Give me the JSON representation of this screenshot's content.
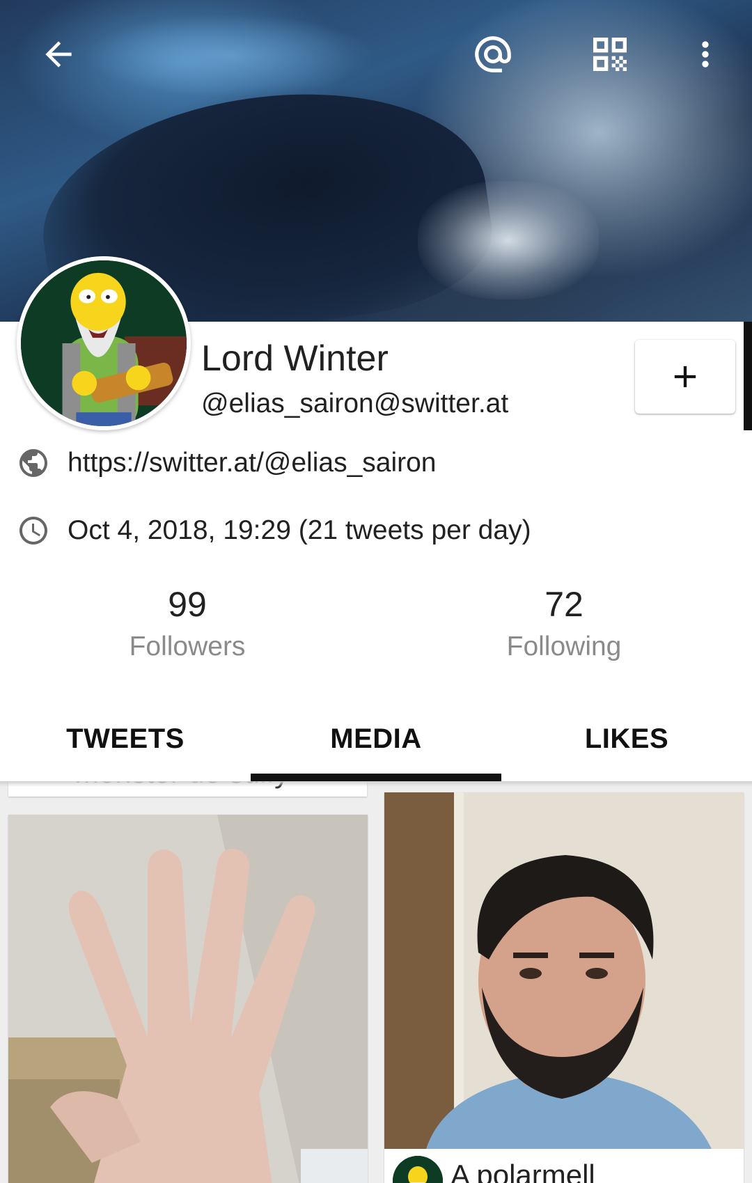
{
  "header": {
    "back_icon": "arrow-back-icon",
    "mention_icon": "at-icon",
    "qr_icon": "qr-code-icon",
    "menu_icon": "more-vert-icon"
  },
  "profile": {
    "display_name": "Lord Winter",
    "handle": "@elias_sairon@switter.at",
    "follow_label": "+",
    "website": "https://switter.at/@elias_sairon",
    "joined": "Oct 4, 2018, 19:29 (21 tweets per day)"
  },
  "stats": {
    "followers_count": "99",
    "followers_label": "Followers",
    "following_count": "72",
    "following_label": "Following"
  },
  "tabs": [
    {
      "label": "TWEETS"
    },
    {
      "label": "MEDIA",
      "selected": true
    },
    {
      "label": "LIKES"
    }
  ],
  "media": {
    "prev_card_text": "monster de sulfy",
    "face_card_caption": "A polarmell"
  },
  "colors": {
    "text_primary": "#212121",
    "text_secondary": "#8a8a8a",
    "tab_indicator": "#111111"
  }
}
